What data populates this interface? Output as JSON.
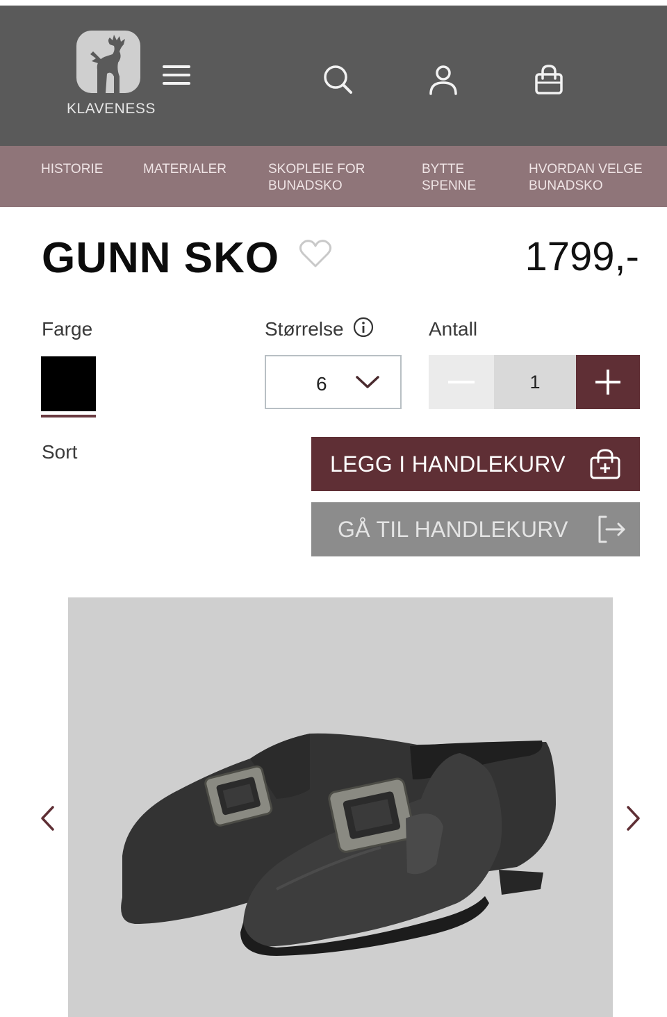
{
  "brand": {
    "name": "KLAVENESS"
  },
  "header": {
    "icons": [
      "deer-logo-icon",
      "menu-icon",
      "search-icon",
      "user-icon",
      "shopping-bag-icon"
    ]
  },
  "subnav": {
    "items": [
      {
        "line1": "HISTORIE",
        "line2": ""
      },
      {
        "line1": "MATERIALER",
        "line2": ""
      },
      {
        "line1": "SKOPLEIE FOR",
        "line2": "BUNADSKO"
      },
      {
        "line1": "BYTTE",
        "line2": "SPENNE"
      },
      {
        "line1": "HVORDAN VELGE",
        "line2": "BUNADSKO"
      }
    ]
  },
  "product": {
    "title": "GUNN SKO",
    "price": "1799,-",
    "color_label": "Farge",
    "color_name": "Sort",
    "color_hex": "#000000",
    "size_label": "Størrelse",
    "size_value": "6",
    "qty_label": "Antall",
    "qty_value": "1"
  },
  "actions": {
    "add_to_cart": "LEGG I HANDLEKURV",
    "go_to_cart": "GÅ TIL HANDLEKURV"
  },
  "colors": {
    "header_bg": "#5a5a5a",
    "subnav_bg": "#8f7579",
    "accent": "#5f2f35",
    "secondary_button": "#8c8c8c",
    "gallery_bg": "#cfcfcf"
  }
}
